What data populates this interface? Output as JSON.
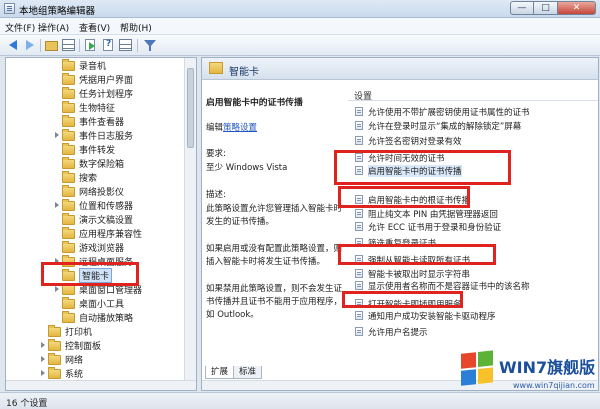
{
  "window": {
    "title": "本地组策略编辑器",
    "controls": [
      "—",
      "□",
      "✕"
    ]
  },
  "menu": [
    "文件(F)",
    "操作(A)",
    "查看(V)",
    "帮助(H)"
  ],
  "toolbar": {
    "icons": [
      "back-arrow-icon",
      "forward-arrow-icon",
      "folder-up-icon",
      "show-hide-tree-icon",
      "export-list-icon",
      "help-icon",
      "properties-icon",
      "filter-icon"
    ]
  },
  "tree": {
    "items": [
      {
        "label": "录音机",
        "expandable": false
      },
      {
        "label": "凭据用户界面",
        "expandable": false
      },
      {
        "label": "任务计划程序",
        "expandable": false
      },
      {
        "label": "生物特征",
        "expandable": false
      },
      {
        "label": "事件查看器",
        "expandable": false
      },
      {
        "label": "事件日志服务",
        "expandable": true
      },
      {
        "label": "事件转发",
        "expandable": false
      },
      {
        "label": "数字保险箱",
        "expandable": false
      },
      {
        "label": "搜索",
        "expandable": false
      },
      {
        "label": "网络投影仪",
        "expandable": false
      },
      {
        "label": "位置和传感器",
        "expandable": true
      },
      {
        "label": "演示文稿设置",
        "expandable": false
      },
      {
        "label": "应用程序兼容性",
        "expandable": false
      },
      {
        "label": "游戏浏览器",
        "expandable": false
      },
      {
        "label": "远程桌面服务",
        "expandable": true
      },
      {
        "label": "智能卡",
        "expandable": false,
        "selected": true
      },
      {
        "label": "桌面窗口管理器",
        "expandable": true
      },
      {
        "label": "桌面小工具",
        "expandable": false
      },
      {
        "label": "自动播放策略",
        "expandable": false
      }
    ],
    "top_items": [
      {
        "label": "打印机",
        "expandable": false
      },
      {
        "label": "控制面板",
        "expandable": true
      },
      {
        "label": "网络",
        "expandable": true
      },
      {
        "label": "系统",
        "expandable": true
      }
    ]
  },
  "right": {
    "header": "智能卡",
    "description": {
      "title": "启用智能卡中的证书传播",
      "edit_prefix": "编辑",
      "edit_link": "策略设置",
      "requirements_label": "要求:",
      "requirements_value": "至少 Windows Vista",
      "description_label": "描述:",
      "paragraph1": [
        "此策略设置允许您管理插入智能卡时",
        "发生的证书传播。"
      ],
      "paragraph2": [
        "如果启用或没有配置此策略设置，则",
        "插入智能卡时将发生证书传播。"
      ],
      "paragraph3": [
        "如果禁用此策略设置，则不会发生证",
        "书传播并且证书不能用于应用程序，",
        "如 Outlook。"
      ]
    },
    "list_header": "设置",
    "policies": [
      "允许使用不带扩展密钥使用证书属性的证书",
      "允许在登录时显示“集成的解除锁定”屏幕",
      "允许签名密钥对登录有效",
      "允许时间无效的证书",
      "启用智能卡中的证书传播",
      "启用智能卡中的根证书传播",
      "阻止纯文本 PIN 由凭据管理器返回",
      "允许 ECC 证书用于登录和身份验证",
      "筛选重复登录证书",
      "强制从智能卡读取所有证书",
      "智能卡被取出时显示字符串",
      "显示使用者名称而不是容器证书中的该名称",
      "打开智能卡即插即用服务",
      "通知用户成功安装智能卡驱动程序",
      "允许用户名提示"
    ],
    "tabs": [
      "扩展",
      "标准"
    ]
  },
  "status": "16 个设置",
  "watermark": {
    "text": "WIN7旗舰版",
    "url": "www.win7qijian.com"
  }
}
